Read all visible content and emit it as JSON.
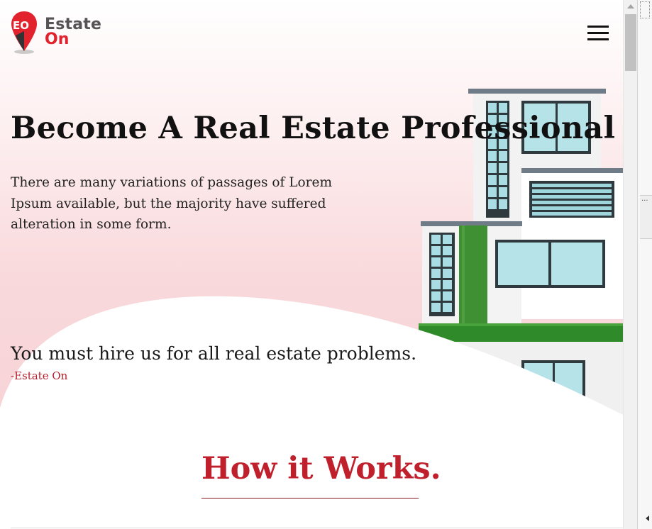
{
  "brand": {
    "name_line1": "Estate",
    "name_line2": "On",
    "logo_icon": "map-pin-icon",
    "colors": {
      "accent": "#e2232e",
      "gray": "#555555"
    }
  },
  "nav": {
    "menu_icon": "hamburger-menu-icon"
  },
  "hero": {
    "title": "Become A Real Estate Professional",
    "description": "There are many variations of passages of Lorem Ipsum available, but the majority have suffered alteration in some form.",
    "tagline": "You must hire us for all real estate problems.",
    "tagline_author": "-Estate On",
    "image": "apartment-building-illustration"
  },
  "how_it_works": {
    "title": "How it Works."
  },
  "theme": {
    "hero_pink": "#f7d3d6",
    "heading_red": "#c0202c"
  }
}
